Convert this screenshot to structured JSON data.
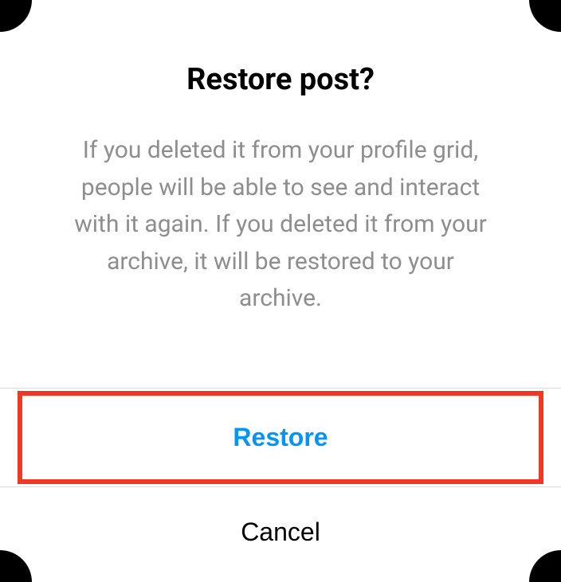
{
  "dialog": {
    "title": "Restore post?",
    "body": "If you deleted it from your profile grid, people will be able to see and interact with it again. If you deleted it from your archive, it will be restored to your archive.",
    "primary_label": "Restore",
    "secondary_label": "Cancel"
  },
  "colors": {
    "accent": "#0095f6",
    "muted_text": "#8e8e8e",
    "highlight_border": "#ee3a24"
  }
}
